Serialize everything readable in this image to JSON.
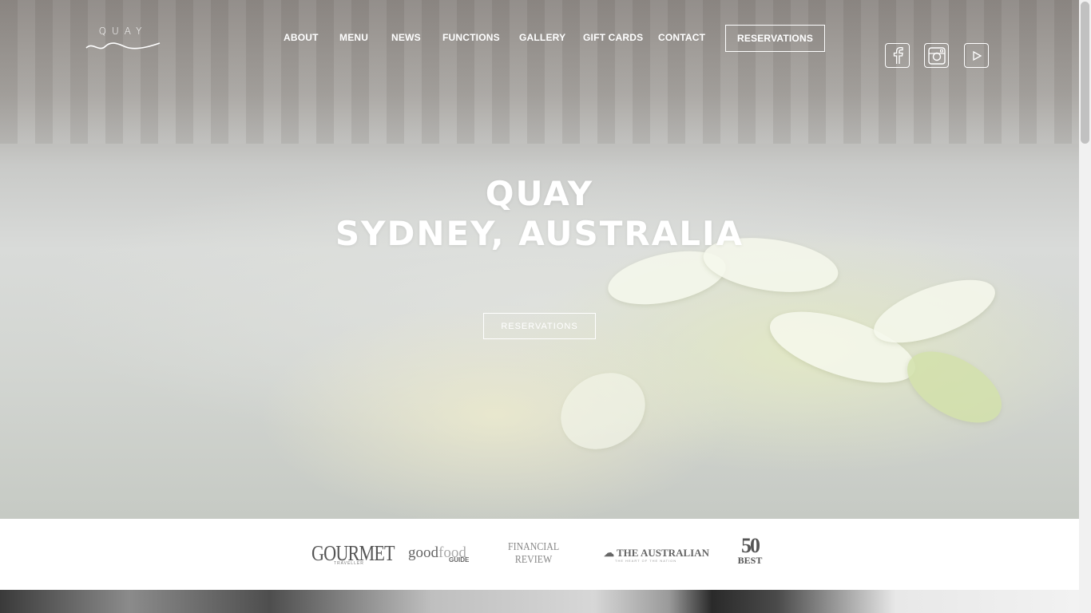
{
  "logo": {
    "text": "QUAY"
  },
  "nav": {
    "items": [
      {
        "label": "ABOUT"
      },
      {
        "label": "MENU"
      },
      {
        "label": "NEWS"
      },
      {
        "label": "FUNCTIONS"
      },
      {
        "label": "GALLERY"
      },
      {
        "label": "GIFT CARDS"
      },
      {
        "label": "CONTACT"
      }
    ],
    "reservations_label": "RESERVATIONS"
  },
  "social": [
    {
      "icon": "facebook-icon"
    },
    {
      "icon": "instagram-icon"
    },
    {
      "icon": "youtube-icon"
    }
  ],
  "hero": {
    "title_line1": "QUAY",
    "title_line2": "SYDNEY, AUSTRALIA",
    "reservations_label": "RESERVATIONS"
  },
  "press": {
    "gourmet": "GOURMET",
    "gourmet_sub": "TRAVELLER",
    "goodfood_1": "good",
    "goodfood_2": "food",
    "goodfood_guide": "GUIDE",
    "financial_1": "FINANCIAL",
    "financial_2": "REVIEW",
    "australian": "THE AUSTRALIAN",
    "australian_sub": "THE HEART OF THE NATION",
    "fifty_num": "50",
    "fifty_best": "BEST"
  }
}
